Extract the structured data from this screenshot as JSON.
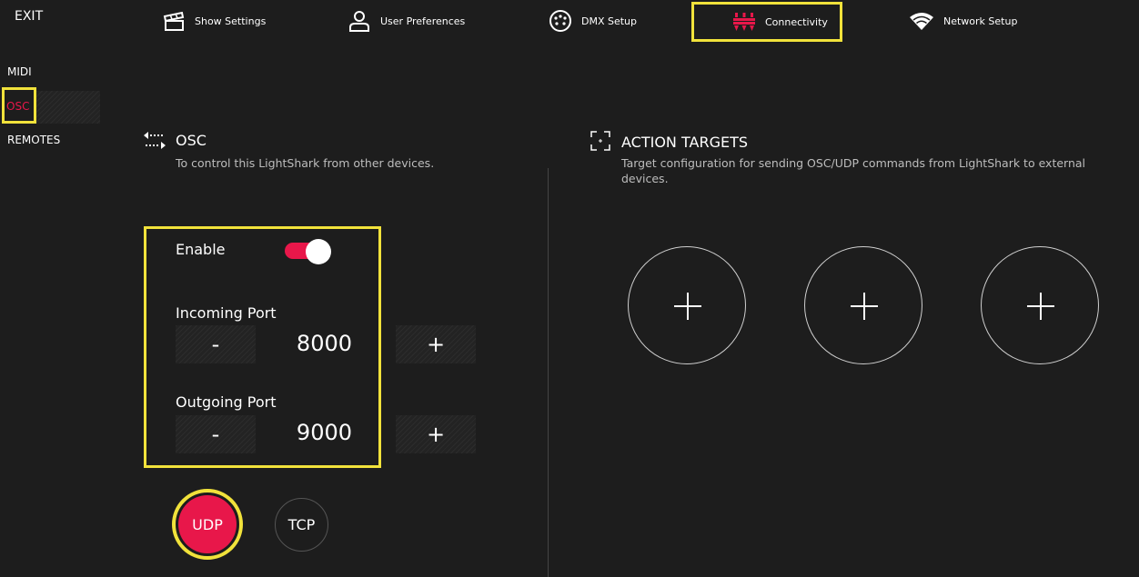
{
  "topbar": {
    "exit_label": "EXIT",
    "tabs": [
      {
        "label": "Show Settings",
        "icon": "show-settings-icon"
      },
      {
        "label": "User Preferences",
        "icon": "user-icon"
      },
      {
        "label": "DMX Setup",
        "icon": "dmx-connector-icon"
      },
      {
        "label": "Connectivity",
        "icon": "connectivity-icon",
        "active": true
      },
      {
        "label": "Network Setup",
        "icon": "wifi-icon"
      }
    ]
  },
  "sidebar": {
    "items": [
      {
        "label": "MIDI"
      },
      {
        "label": "OSC",
        "active": true
      },
      {
        "label": "REMOTES"
      }
    ]
  },
  "osc": {
    "title": "OSC",
    "subtitle": "To control this LightShark from other devices.",
    "enable_label": "Enable",
    "enabled": true,
    "incoming_label": "Incoming Port",
    "incoming_value": "8000",
    "outgoing_label": "Outgoing Port",
    "outgoing_value": "9000",
    "minus": "-",
    "plus": "+",
    "protocols": [
      "UDP",
      "TCP"
    ],
    "selected_protocol": "UDP"
  },
  "action_targets": {
    "title": "ACTION TARGETS",
    "subtitle_line1": "Target configuration for sending OSC/UDP commands from LightShark to external",
    "subtitle_line2": "devices.",
    "slot_count": 3
  },
  "colors": {
    "background": "#1d1d1d",
    "accent": "#e8174a",
    "highlight": "#f1e23b",
    "text": "#ffffff",
    "muted_text": "#bdbdbd"
  }
}
